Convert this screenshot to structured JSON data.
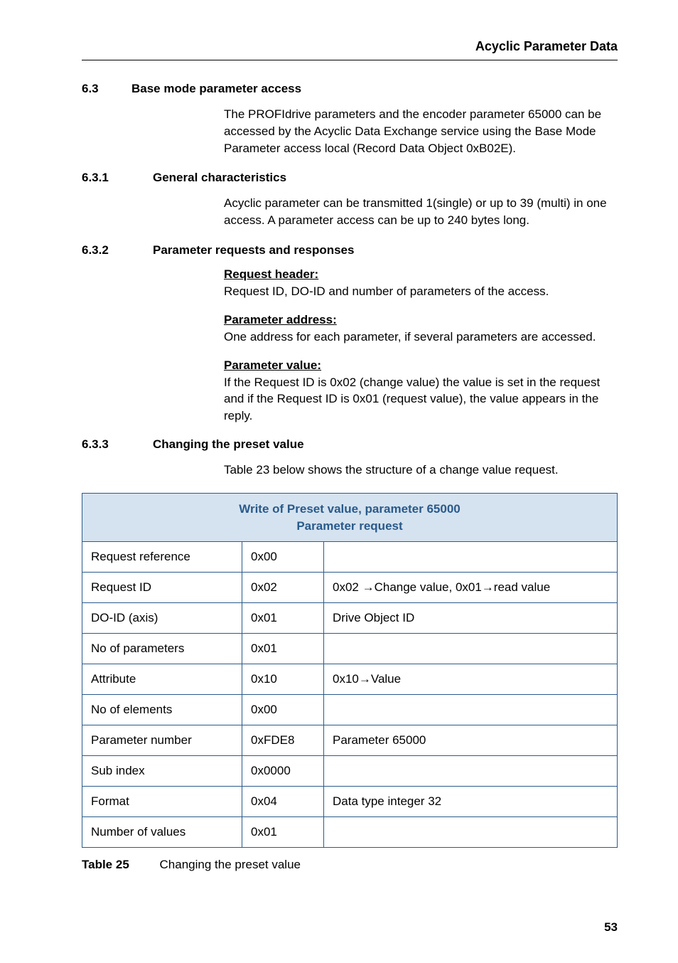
{
  "header": {
    "title": "Acyclic Parameter Data"
  },
  "sec63": {
    "num": "6.3",
    "title": "Base mode parameter access",
    "body": "The PROFIdrive parameters and the encoder parameter 65000 can be accessed by the Acyclic Data Exchange service using the Base Mode Parameter access local (Record Data Object 0xB02E)."
  },
  "sec631": {
    "num": "6.3.1",
    "title": "General characteristics",
    "body": "Acyclic parameter can be transmitted 1(single) or up to 39 (multi) in one access. A parameter access can be up to 240 bytes long."
  },
  "sec632": {
    "num": "6.3.2",
    "title": "Parameter requests and responses",
    "reqhdr_label": "Request header:",
    "reqhdr_body": "Request ID, DO-ID and number of parameters of the access.",
    "paddr_label": "Parameter address:",
    "paddr_body": "One address for each parameter, if several parameters are accessed.",
    "pval_label": "Parameter value:",
    "pval_body": "If the Request ID is 0x02 (change value) the value is set in the request and if the Request ID is 0x01 (request value), the value appears in the reply."
  },
  "sec633": {
    "num": "6.3.3",
    "title": "Changing the preset value",
    "body": "Table 23 below shows the structure of a change value request."
  },
  "table": {
    "header_l1": "Write of Preset value, parameter 65000",
    "header_l2": "Parameter request",
    "rows": [
      {
        "c1": "Request reference",
        "c2": "0x00",
        "c3": ""
      },
      {
        "c1": "Request ID",
        "c2": "0x02",
        "c3": "0x02 →Change value, 0x01→read value"
      },
      {
        "c1": "DO-ID (axis)",
        "c2": "0x01",
        "c3": "Drive Object ID"
      },
      {
        "c1": "No of parameters",
        "c2": "0x01",
        "c3": ""
      },
      {
        "c1": "Attribute",
        "c2": "0x10",
        "c3": "0x10→Value"
      },
      {
        "c1": "No of elements",
        "c2": "0x00",
        "c3": ""
      },
      {
        "c1": "Parameter number",
        "c2": "0xFDE8",
        "c3": "Parameter 65000"
      },
      {
        "c1": "Sub index",
        "c2": "0x0000",
        "c3": ""
      },
      {
        "c1": "Format",
        "c2": "0x04",
        "c3": "Data type integer 32"
      },
      {
        "c1": "Number of values",
        "c2": "0x01",
        "c3": ""
      }
    ]
  },
  "caption": {
    "label": "Table 25",
    "text": "Changing the preset value"
  },
  "page_number": "53"
}
